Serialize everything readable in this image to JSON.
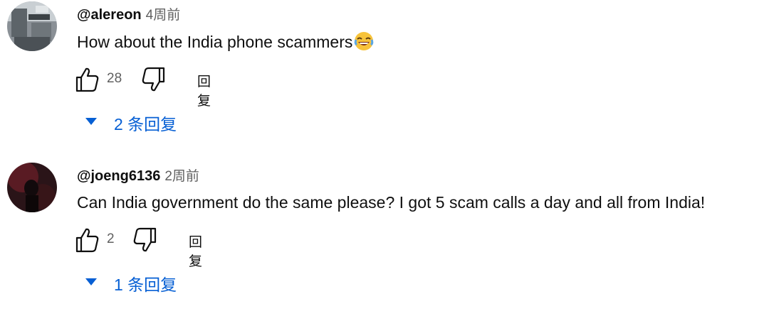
{
  "comments": [
    {
      "author": "@alereon",
      "time": "4周前",
      "text": "How about the India phone scammers",
      "emoji": "😂",
      "likes": "28",
      "reply_label": "回复",
      "replies_label": "2 条回复"
    },
    {
      "author": "@joeng6136",
      "time": "2周前",
      "text": "Can India government do the same please? I got 5 scam calls a day and all from India!",
      "likes": "2",
      "reply_label": "回复",
      "replies_label": "1 条回复"
    }
  ],
  "icons": {
    "like": "thumbs-up-icon",
    "dislike": "thumbs-down-icon",
    "expand": "caret-down-icon"
  },
  "colors": {
    "link_blue": "#065fd4",
    "secondary_text": "#606060",
    "primary_text": "#0f0f0f"
  }
}
